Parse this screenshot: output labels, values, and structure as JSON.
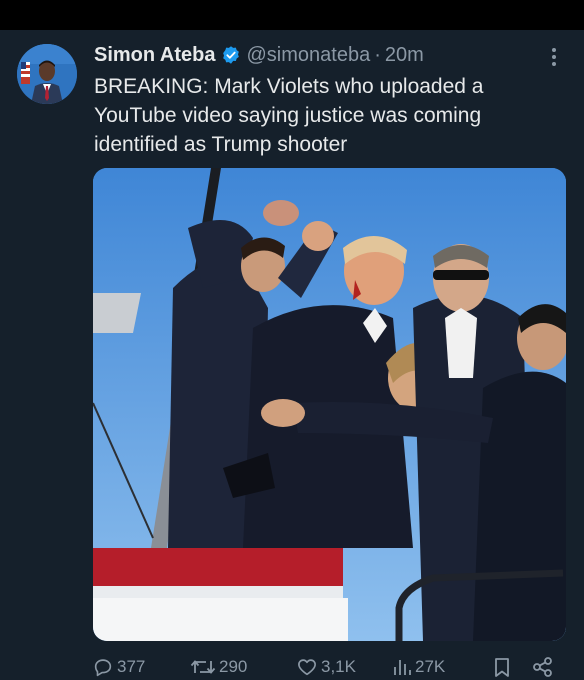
{
  "tweet": {
    "author": {
      "display_name": "Simon Ateba",
      "handle": "@simonateba",
      "separator": "·",
      "time_ago": "20m",
      "verified": true
    },
    "text_lines": [
      "BREAKING: Mark Violets who uploaded a",
      "YouTube video saying justice was coming",
      "identified as Trump shooter"
    ],
    "media": {
      "kind": "photo"
    },
    "metrics": {
      "replies": "377",
      "reposts": "290",
      "likes": "3,1K",
      "views": "27K"
    }
  },
  "icons": {
    "verified": "verified-badge-icon",
    "more": "more-options-icon",
    "reply": "reply-icon",
    "repost": "repost-icon",
    "like": "heart-icon",
    "views": "views-chart-icon",
    "bookmark": "bookmark-icon",
    "share": "share-icon"
  },
  "colors": {
    "background": "#15202b",
    "text": "#e7e9ea",
    "muted": "#8b98a5",
    "verified": "#1d9bf0"
  }
}
